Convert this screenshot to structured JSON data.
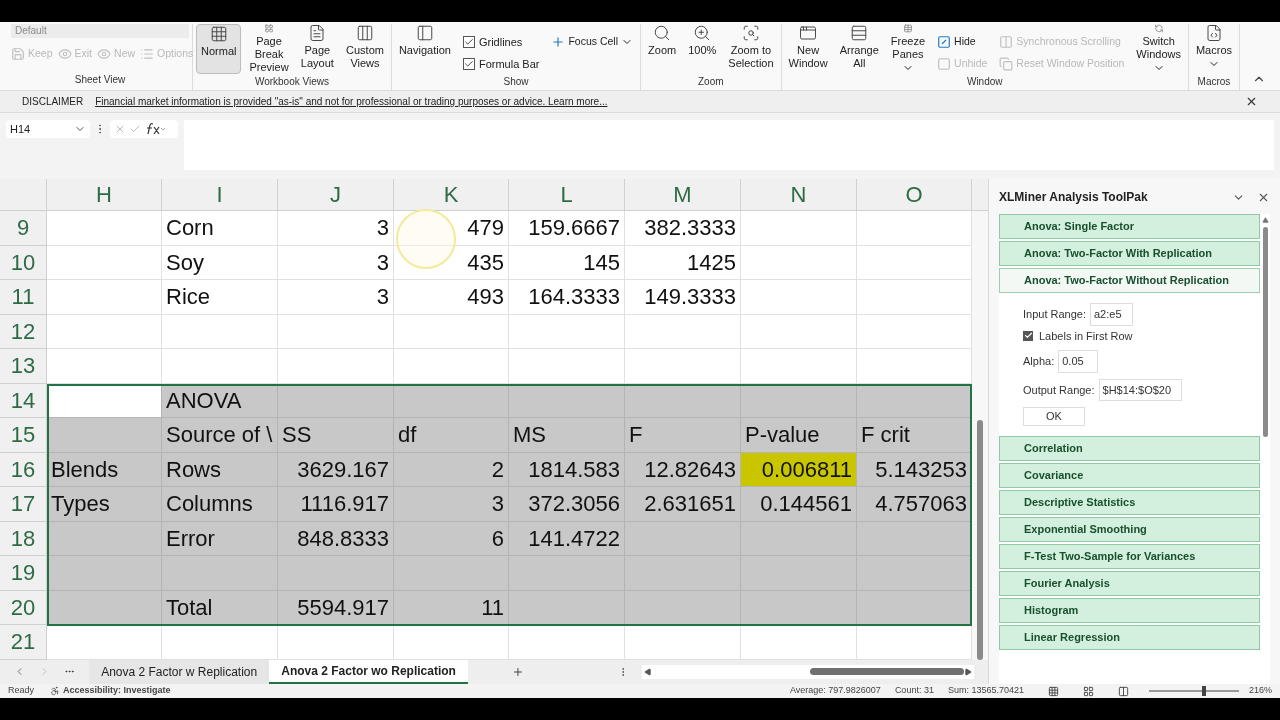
{
  "ribbon": {
    "groups": [
      {
        "label": "Sheet View",
        "items": [
          {
            "label": "Default",
            "kind": "dropdown",
            "disabled": true
          },
          {
            "label": "Keep",
            "kind": "inline",
            "disabled": true
          },
          {
            "label": "Exit",
            "kind": "inline",
            "disabled": true
          },
          {
            "label": "New",
            "kind": "inline",
            "disabled": true
          },
          {
            "label": "Options",
            "kind": "inline",
            "disabled": true
          }
        ]
      },
      {
        "label": "Workbook Views",
        "items": [
          {
            "label": "Normal",
            "kind": "large",
            "selected": true
          },
          {
            "label": "Page Break Preview",
            "kind": "large",
            "selected": false
          },
          {
            "label": "Page Layout",
            "kind": "large",
            "selected": false
          },
          {
            "label": "Custom Views",
            "kind": "large",
            "selected": false
          }
        ]
      },
      {
        "label": "Show",
        "items": [
          {
            "label": "Navigation",
            "kind": "large",
            "selected": false
          },
          {
            "label": "Gridlines",
            "kind": "check",
            "checked": true
          },
          {
            "label": "Formula Bar",
            "kind": "check",
            "checked": true
          },
          {
            "label": "Focus Cell",
            "kind": "small",
            "menu": true
          }
        ]
      },
      {
        "label": "Zoom",
        "items": [
          {
            "label": "Zoom",
            "kind": "large",
            "selected": false
          },
          {
            "label": "100%",
            "kind": "large",
            "selected": false
          },
          {
            "label": "Zoom to Selection",
            "kind": "large",
            "selected": false
          }
        ]
      },
      {
        "label": "Window",
        "items": [
          {
            "label": "New Window",
            "kind": "large",
            "selected": false
          },
          {
            "label": "Arrange All",
            "kind": "large",
            "selected": false
          },
          {
            "label": "Freeze Panes",
            "kind": "large",
            "selected": false,
            "menu": true
          },
          {
            "label": "Hide",
            "kind": "small",
            "disabled": false
          },
          {
            "label": "Unhide",
            "kind": "small",
            "disabled": true
          },
          {
            "label": "Synchronous Scrolling",
            "kind": "small",
            "disabled": true
          },
          {
            "label": "Reset Window Position",
            "kind": "small",
            "disabled": true
          },
          {
            "label": "Switch Windows",
            "kind": "large",
            "selected": false,
            "menu": true
          }
        ]
      },
      {
        "label": "Macros",
        "items": [
          {
            "label": "Macros",
            "kind": "large",
            "selected": false,
            "menu": true
          }
        ]
      }
    ]
  },
  "disclaimer": {
    "label": "DISCLAIMER",
    "text": "Financial market information is provided \"as-is\" and not for professional or trading purposes or advice. Learn more..."
  },
  "formula_bar": {
    "name_box": "H14"
  },
  "sheet": {
    "columns": [
      "H",
      "I",
      "J",
      "K",
      "L",
      "M",
      "N",
      "O"
    ],
    "rows": [
      {
        "number": "9",
        "selected": false,
        "cells": [
          null,
          {
            "text": "Corn",
            "kind": "text"
          },
          {
            "text": "3",
            "kind": "num"
          },
          {
            "text": "479",
            "kind": "num"
          },
          {
            "text": "159.6667",
            "kind": "num"
          },
          {
            "text": "382.3333",
            "kind": "num"
          },
          null,
          null
        ]
      },
      {
        "number": "10",
        "selected": false,
        "cells": [
          null,
          {
            "text": "Soy",
            "kind": "text"
          },
          {
            "text": "3",
            "kind": "num"
          },
          {
            "text": "435",
            "kind": "num"
          },
          {
            "text": "145",
            "kind": "num"
          },
          {
            "text": "1425",
            "kind": "num"
          },
          null,
          null
        ]
      },
      {
        "number": "11",
        "selected": false,
        "cells": [
          null,
          {
            "text": "Rice",
            "kind": "text"
          },
          {
            "text": "3",
            "kind": "num"
          },
          {
            "text": "493",
            "kind": "num"
          },
          {
            "text": "164.3333",
            "kind": "num"
          },
          {
            "text": "149.3333",
            "kind": "num"
          },
          null,
          null
        ]
      },
      {
        "number": "12",
        "selected": false,
        "cells": [
          null,
          null,
          null,
          null,
          null,
          null,
          null,
          null
        ]
      },
      {
        "number": "13",
        "selected": false,
        "cells": [
          null,
          null,
          null,
          null,
          null,
          null,
          null,
          null
        ]
      },
      {
        "number": "14",
        "selected": true,
        "cells": [
          {
            "active": true
          },
          {
            "text": "ANOVA",
            "kind": "text"
          },
          null,
          null,
          null,
          null,
          null,
          null
        ]
      },
      {
        "number": "15",
        "selected": true,
        "cells": [
          null,
          {
            "text": "Source of \\",
            "kind": "text"
          },
          {
            "text": "SS",
            "kind": "text"
          },
          {
            "text": "df",
            "kind": "text"
          },
          {
            "text": "MS",
            "kind": "text"
          },
          {
            "text": "F",
            "kind": "text"
          },
          {
            "text": "P-value",
            "kind": "text"
          },
          {
            "text": "F crit",
            "kind": "text"
          }
        ]
      },
      {
        "number": "16",
        "selected": true,
        "cells": [
          {
            "text": "Blends",
            "kind": "text"
          },
          {
            "text": "Rows",
            "kind": "text"
          },
          {
            "text": "3629.167",
            "kind": "num"
          },
          {
            "text": "2",
            "kind": "num"
          },
          {
            "text": "1814.583",
            "kind": "num"
          },
          {
            "text": "12.82643",
            "kind": "num"
          },
          {
            "text": "0.006811",
            "kind": "num",
            "highlighted": true
          },
          {
            "text": "5.143253",
            "kind": "num"
          }
        ]
      },
      {
        "number": "17",
        "selected": true,
        "cells": [
          {
            "text": "Types",
            "kind": "text"
          },
          {
            "text": "Columns",
            "kind": "text"
          },
          {
            "text": "1116.917",
            "kind": "num"
          },
          {
            "text": "3",
            "kind": "num"
          },
          {
            "text": "372.3056",
            "kind": "num"
          },
          {
            "text": "2.631651",
            "kind": "num"
          },
          {
            "text": "0.144561",
            "kind": "num"
          },
          {
            "text": "4.757063",
            "kind": "num"
          }
        ]
      },
      {
        "number": "18",
        "selected": true,
        "cells": [
          null,
          {
            "text": "Error",
            "kind": "text"
          },
          {
            "text": "848.8333",
            "kind": "num"
          },
          {
            "text": "6",
            "kind": "num"
          },
          {
            "text": "141.4722",
            "kind": "num"
          },
          null,
          null,
          null
        ]
      },
      {
        "number": "19",
        "selected": true,
        "cells": [
          null,
          null,
          null,
          null,
          null,
          null,
          null,
          null
        ]
      },
      {
        "number": "20",
        "selected": true,
        "cells": [
          null,
          {
            "text": "Total",
            "kind": "text"
          },
          {
            "text": "5594.917",
            "kind": "num"
          },
          {
            "text": "11",
            "kind": "num"
          },
          null,
          null,
          null,
          null
        ]
      },
      {
        "number": "21",
        "selected": false,
        "cells": [
          null,
          null,
          null,
          null,
          null,
          null,
          null,
          null
        ]
      }
    ]
  },
  "sheet_tabs": [
    {
      "label": "Anova 2 Factor w Replication",
      "selected": false
    },
    {
      "label": "Anova 2 Factor wo Replication",
      "selected": true
    }
  ],
  "status_bar": {
    "mode": "Ready",
    "accessibility": "Accessibility: Investigate",
    "average": "Average: 797.9826007",
    "count": "Count: 31",
    "sum": "Sum: 13565.70421",
    "zoom": "216%",
    "zoom_slider": {
      "level": 0.62
    }
  },
  "panel": {
    "title": "XLMiner Analysis ToolPak",
    "tools": [
      {
        "label": "Anova: Single Factor",
        "expanded": false
      },
      {
        "label": "Anova: Two-Factor With Replication",
        "expanded": false
      },
      {
        "label": "Anova: Two-Factor Without Replication",
        "expanded": true
      },
      {
        "label": "Correlation",
        "expanded": false
      },
      {
        "label": "Covariance",
        "expanded": false
      },
      {
        "label": "Descriptive Statistics",
        "expanded": false
      },
      {
        "label": "Exponential Smoothing",
        "expanded": false
      },
      {
        "label": "F-Test Two-Sample for Variances",
        "expanded": false
      },
      {
        "label": "Fourier Analysis",
        "expanded": false
      },
      {
        "label": "Histogram",
        "expanded": false
      },
      {
        "label": "Linear Regression",
        "expanded": false
      }
    ],
    "form": [
      {
        "kind": "field",
        "label": "Input Range:",
        "value": "a2:e5"
      },
      {
        "kind": "checkbox",
        "label": "Labels in First Row",
        "checked": true
      },
      {
        "kind": "field",
        "label": "Alpha:",
        "value": "0.05"
      },
      {
        "kind": "field",
        "label": "Output Range:",
        "value": "$H$14:$O$20"
      }
    ],
    "ok_button": "OK"
  }
}
